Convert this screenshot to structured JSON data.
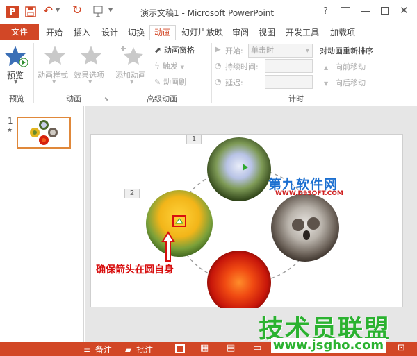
{
  "app": {
    "title": "演示文稿1 - Microsoft PowerPoint",
    "help": "?"
  },
  "tabs": [
    "文件",
    "开始",
    "插入",
    "设计",
    "切换",
    "动画",
    "幻灯片放映",
    "审阅",
    "视图",
    "开发工具",
    "加载项"
  ],
  "ribbon": {
    "preview": {
      "label": "预览",
      "group": "预览"
    },
    "animation": {
      "styles": "动画样式",
      "effects": "效果选项",
      "group": "动画"
    },
    "advanced": {
      "add": "添加动画",
      "pane": "动画窗格",
      "trigger": "触发",
      "painter": "动画刷",
      "group": "高级动画"
    },
    "timing": {
      "start_label": "开始:",
      "start_value": "单击时",
      "duration_label": "持续时间:",
      "delay_label": "延迟:",
      "group": "计时"
    },
    "reorder": {
      "title": "对动画重新排序",
      "forward": "向前移动",
      "backward": "向后移动"
    }
  },
  "slide_thumb": {
    "number": "1",
    "star": "★"
  },
  "slide": {
    "label_1": "1",
    "label_2": "2",
    "annotation": "确保箭头在圆自身",
    "watermark_1": "第九软件网",
    "watermark_1_url": "WWW.D9SOFT.COM"
  },
  "watermark": {
    "title": "技术员联盟",
    "url": "www.jsgho.com"
  },
  "status": {
    "notes": "备注",
    "comments": "批注"
  },
  "colors": {
    "accent": "#d24726",
    "annotation": "#d80f0f",
    "watermark_green": "#2bb230",
    "watermark_blue": "#1b6fd0"
  },
  "icons": [
    "powerpoint-logo-icon",
    "save-icon",
    "undo-icon",
    "redo-icon",
    "touch-mode-icon",
    "preview-star-icon",
    "animation-style-star-icon",
    "effect-options-star-icon",
    "add-animation-star-icon",
    "animation-pane-icon",
    "trigger-icon",
    "animation-painter-icon",
    "start-icon",
    "duration-clock-icon",
    "delay-clock-icon",
    "move-earlier-icon",
    "move-later-icon",
    "help-icon",
    "ribbon-display-icon",
    "minimize-icon",
    "restore-icon",
    "close-icon",
    "notes-icon",
    "comments-icon",
    "normal-view-icon",
    "slide-sorter-icon",
    "reading-view-icon",
    "slideshow-icon",
    "fit-window-icon"
  ]
}
